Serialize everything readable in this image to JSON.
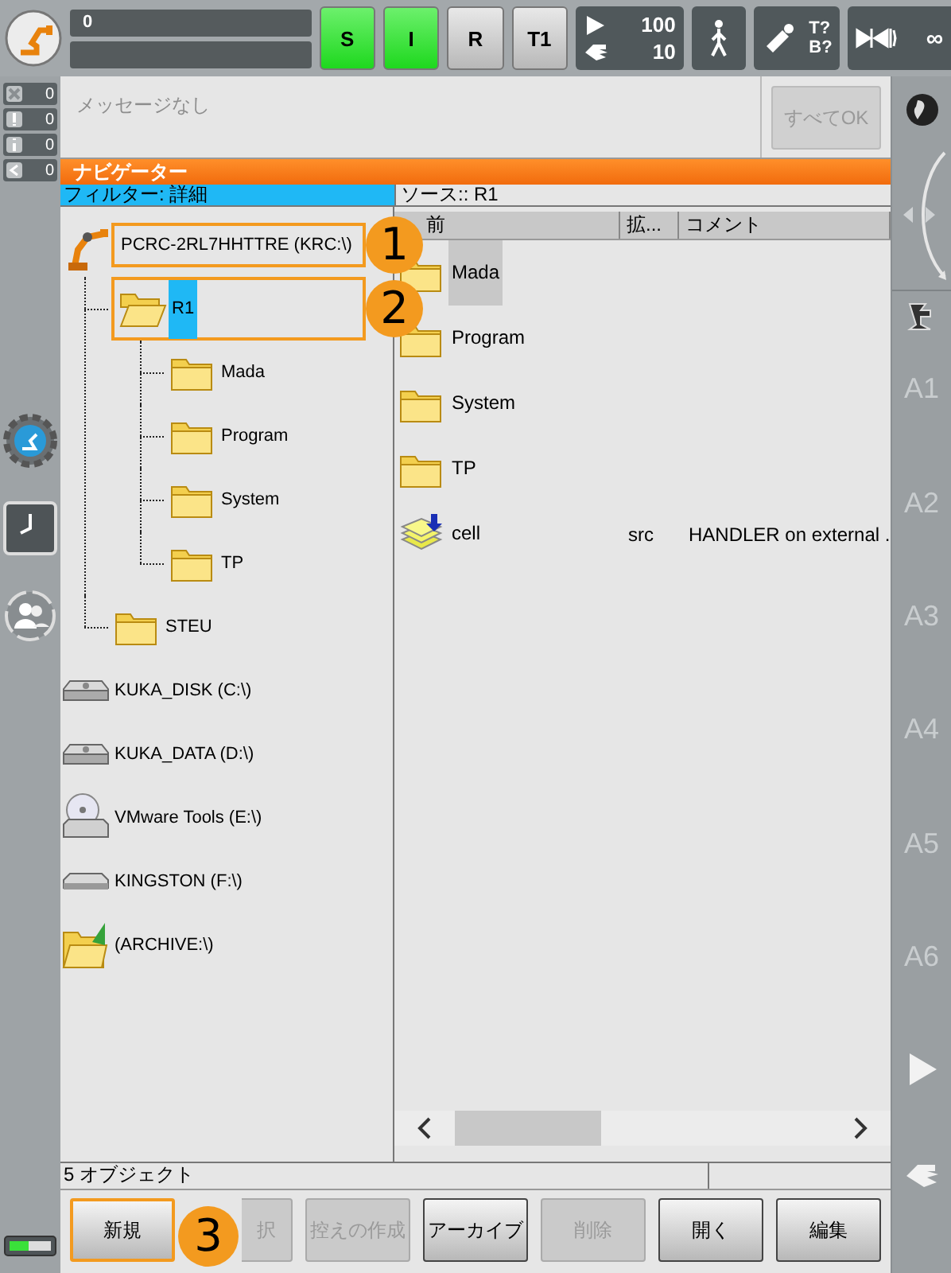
{
  "top_bar": {
    "progress": "0",
    "status_keys": [
      {
        "label": "S",
        "on": true
      },
      {
        "label": "I",
        "on": true
      },
      {
        "label": "R",
        "on": false
      },
      {
        "label": "T1",
        "on": false
      }
    ],
    "override": {
      "program": "100",
      "jog": "10"
    },
    "tool": {
      "tool": "T?",
      "base": "B?"
    },
    "run_mode": "∞"
  },
  "message_counters": [
    {
      "kind": "error",
      "count": "0"
    },
    {
      "kind": "warning",
      "count": "0"
    },
    {
      "kind": "info",
      "count": "0"
    },
    {
      "kind": "dialog",
      "count": "0"
    }
  ],
  "messages": {
    "text": "メッセージなし",
    "ok_button": {
      "label": "すべてOK",
      "disabled": true
    }
  },
  "navigator": {
    "title": "ナビゲーター",
    "filter": "フィルター: 詳細",
    "source": "ソース:: R1",
    "tree": [
      {
        "kind": "robot",
        "name": "PCRC-2RL7HHTTRE (KRC:\\)",
        "selected": false,
        "callout": "1",
        "children": [
          {
            "kind": "folder",
            "name": "R1",
            "selected": true,
            "expanded": true,
            "callout": "2",
            "children": [
              {
                "kind": "folder",
                "name": "Mada",
                "selected": false,
                "expanded": false
              },
              {
                "kind": "folder",
                "name": "Program",
                "selected": false,
                "expanded": false
              },
              {
                "kind": "folder",
                "name": "System",
                "selected": false,
                "expanded": false
              },
              {
                "kind": "folder",
                "name": "TP",
                "selected": false,
                "expanded": false
              }
            ]
          },
          {
            "kind": "folder",
            "name": "STEU",
            "selected": false,
            "expanded": false
          }
        ]
      },
      {
        "kind": "drive",
        "name": "KUKA_DISK (C:\\)",
        "selected": false
      },
      {
        "kind": "drive",
        "name": "KUKA_DATA (D:\\)",
        "selected": false
      },
      {
        "kind": "cd",
        "name": "VMware Tools (E:\\)",
        "selected": false
      },
      {
        "kind": "usb",
        "name": "KINGSTON (F:\\)",
        "selected": false
      },
      {
        "kind": "archive",
        "name": "(ARCHIVE:\\)",
        "selected": false
      }
    ],
    "columns": [
      "前",
      "拡...",
      "コメント"
    ],
    "files": [
      {
        "kind": "folder",
        "name": "Mada",
        "selected": true
      },
      {
        "kind": "folder",
        "name": "Program",
        "selected": false
      },
      {
        "kind": "folder",
        "name": "System",
        "selected": false
      },
      {
        "kind": "folder",
        "name": "TP",
        "selected": false
      },
      {
        "kind": "module",
        "name": "cell",
        "extension": "src",
        "comment": "HANDLER on external .",
        "selected": false
      }
    ],
    "status": "5 オブジェクト"
  },
  "axes": [
    "A1",
    "A2",
    "A3",
    "A4",
    "A5",
    "A6"
  ],
  "buttons": [
    {
      "label": "新規",
      "disabled": false,
      "callout": "3"
    },
    {
      "label": "択",
      "disabled": true
    },
    {
      "label": "控えの作成",
      "disabled": true
    },
    {
      "label": "アーカイブ",
      "disabled": false
    },
    {
      "label": "削除",
      "disabled": true
    },
    {
      "label": "開く",
      "disabled": false
    },
    {
      "label": "編集",
      "disabled": false
    }
  ]
}
